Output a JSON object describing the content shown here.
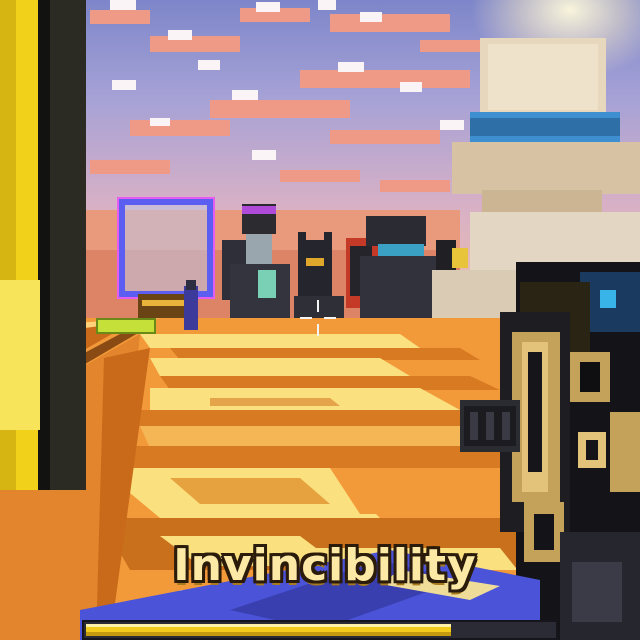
{
  "hud": {
    "effect_title": "Invincibility",
    "effect_progress": 0.78
  },
  "colors": {
    "title_fill": "#fce9a5",
    "title_outline": "#2a1b0a",
    "progress_fill": "#f2cb1c",
    "floor": "#f29a3a",
    "pillar": "#f2d11a",
    "portal": "#5b5ef0"
  },
  "icons": {
    "crosshair": "crosshair-icon"
  }
}
